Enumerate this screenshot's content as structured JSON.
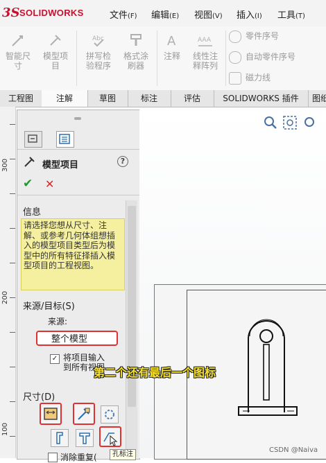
{
  "app": {
    "logo_ds": "3S",
    "logo_text": "SOLIDWORKS"
  },
  "menu": [
    {
      "label": "文件",
      "acc": "(F)"
    },
    {
      "label": "编辑",
      "acc": "(E)"
    },
    {
      "label": "视图",
      "acc": "(V)"
    },
    {
      "label": "插入",
      "acc": "(I)"
    },
    {
      "label": "工具",
      "acc": "(T)"
    }
  ],
  "ribbon": {
    "buttons": [
      {
        "label": "智能尺\n寸",
        "icon": "smart-dimension-icon"
      },
      {
        "label": "模型项\n目",
        "icon": "model-items-icon"
      },
      {
        "label": "拼写检\n验程序",
        "icon": "spell-checker-icon"
      },
      {
        "label": "格式涂\n刷器",
        "icon": "format-painter-icon"
      },
      {
        "label": "注释",
        "icon": "note-icon"
      },
      {
        "label": "线性注\n释阵列",
        "icon": "linear-note-pattern-icon"
      }
    ],
    "small": [
      {
        "label": "零件序号",
        "icon": "balloon-icon"
      },
      {
        "label": "自动零件序号",
        "icon": "auto-balloon-icon"
      },
      {
        "label": "磁力线",
        "icon": "magnetic-line-icon"
      }
    ]
  },
  "tabs": [
    {
      "label": "工程图",
      "active": false
    },
    {
      "label": "注解",
      "active": true
    },
    {
      "label": "草图",
      "active": false
    },
    {
      "label": "标注",
      "active": false
    },
    {
      "label": "评估",
      "active": false
    },
    {
      "label": "SOLIDWORKS 插件",
      "active": false
    },
    {
      "label": "图纸",
      "active": false
    }
  ],
  "ruler": {
    "labels": [
      "300",
      "200",
      "100"
    ]
  },
  "pm": {
    "title": "模型项目",
    "ok": "✔",
    "cancel": "✕",
    "help": "?",
    "info": {
      "header": "信息",
      "text": "请选择您想从尺寸、注解、或参考几何体组想插入的模型项目类型后为模型中的所有特征择插入模型项目的工程视图。"
    },
    "source": {
      "header": "来源/目标(S)",
      "label": "来源:",
      "value": "整个模型",
      "checkbox_label": "将项目输入到所有视图",
      "checkbox_checked": true
    },
    "dimensions": {
      "header": "尺寸(D)",
      "eliminate_label": "消除重复(",
      "tooltip": "孔标注"
    }
  },
  "caption": "第二个还有最后一个图标",
  "watermark": "CSDN @Naiva",
  "colors": {
    "accent_red": "#c8102e",
    "highlight_frame": "#e03030",
    "info_bg": "#f5f0a0",
    "ok_green": "#1c9a2f"
  }
}
